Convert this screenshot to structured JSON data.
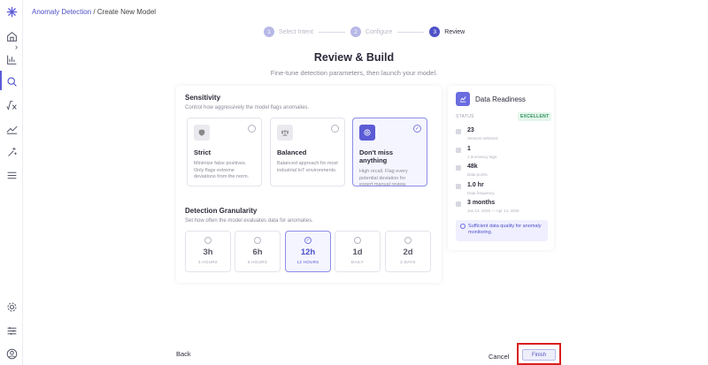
{
  "breadcrumb": {
    "parent": "Anomaly Detection",
    "separator": " / ",
    "current": "Create New Model"
  },
  "stepper": [
    {
      "num": "1",
      "label": "Select Intent",
      "state": "done"
    },
    {
      "num": "2",
      "label": "Configure",
      "state": "done"
    },
    {
      "num": "3",
      "label": "Review",
      "state": "current"
    }
  ],
  "page": {
    "title": "Review & Build",
    "subtitle": "Fine-tune detection parameters, then launch your model."
  },
  "sensitivity": {
    "title": "Sensitivity",
    "description": "Control how aggressively the model flags anomalies.",
    "options": [
      {
        "name": "Strict",
        "desc": "Minimize false positives. Only flags extreme deviations from the norm.",
        "selected": false
      },
      {
        "name": "Balanced",
        "desc": "Balanced approach for most industrial IoT environments.",
        "selected": false
      },
      {
        "name": "Don't miss anything",
        "desc": "High recall. Flag every potential deviation for expert manual review.",
        "selected": true
      }
    ]
  },
  "granularity": {
    "title": "Detection Granularity",
    "description": "Set how often the model evaluates data for anomalies.",
    "options": [
      {
        "value": "3h",
        "sub": "3 HOURS",
        "selected": false
      },
      {
        "value": "6h",
        "sub": "6 HOURS",
        "selected": false
      },
      {
        "value": "12h",
        "sub": "12 HOURS",
        "selected": true
      },
      {
        "value": "1d",
        "sub": "DAILY",
        "selected": false
      },
      {
        "value": "2d",
        "sub": "2 DAYS",
        "selected": false
      }
    ]
  },
  "data_readiness": {
    "title": "Data Readiness",
    "status_label": "STATUS",
    "status_value": "EXCELLENT",
    "metrics": [
      {
        "value": "23",
        "label": "Sensors selected"
      },
      {
        "value": "1",
        "label": "1 dormancy tags"
      },
      {
        "value": "48k",
        "label": "Data points"
      },
      {
        "value": "1.0 hr",
        "label": "Data frequency"
      },
      {
        "value": "3 months",
        "label": "Jan 13, 2026 — Apr 14, 2026"
      }
    ],
    "note": "Sufficient data quality for anomaly monitoring."
  },
  "footer": {
    "back": "Back",
    "cancel": "Cancel",
    "finish": "Finish"
  },
  "colors": {
    "accent": "#5b5bd6",
    "highlight": "#d81e1e",
    "success": "#2f8f5b"
  }
}
